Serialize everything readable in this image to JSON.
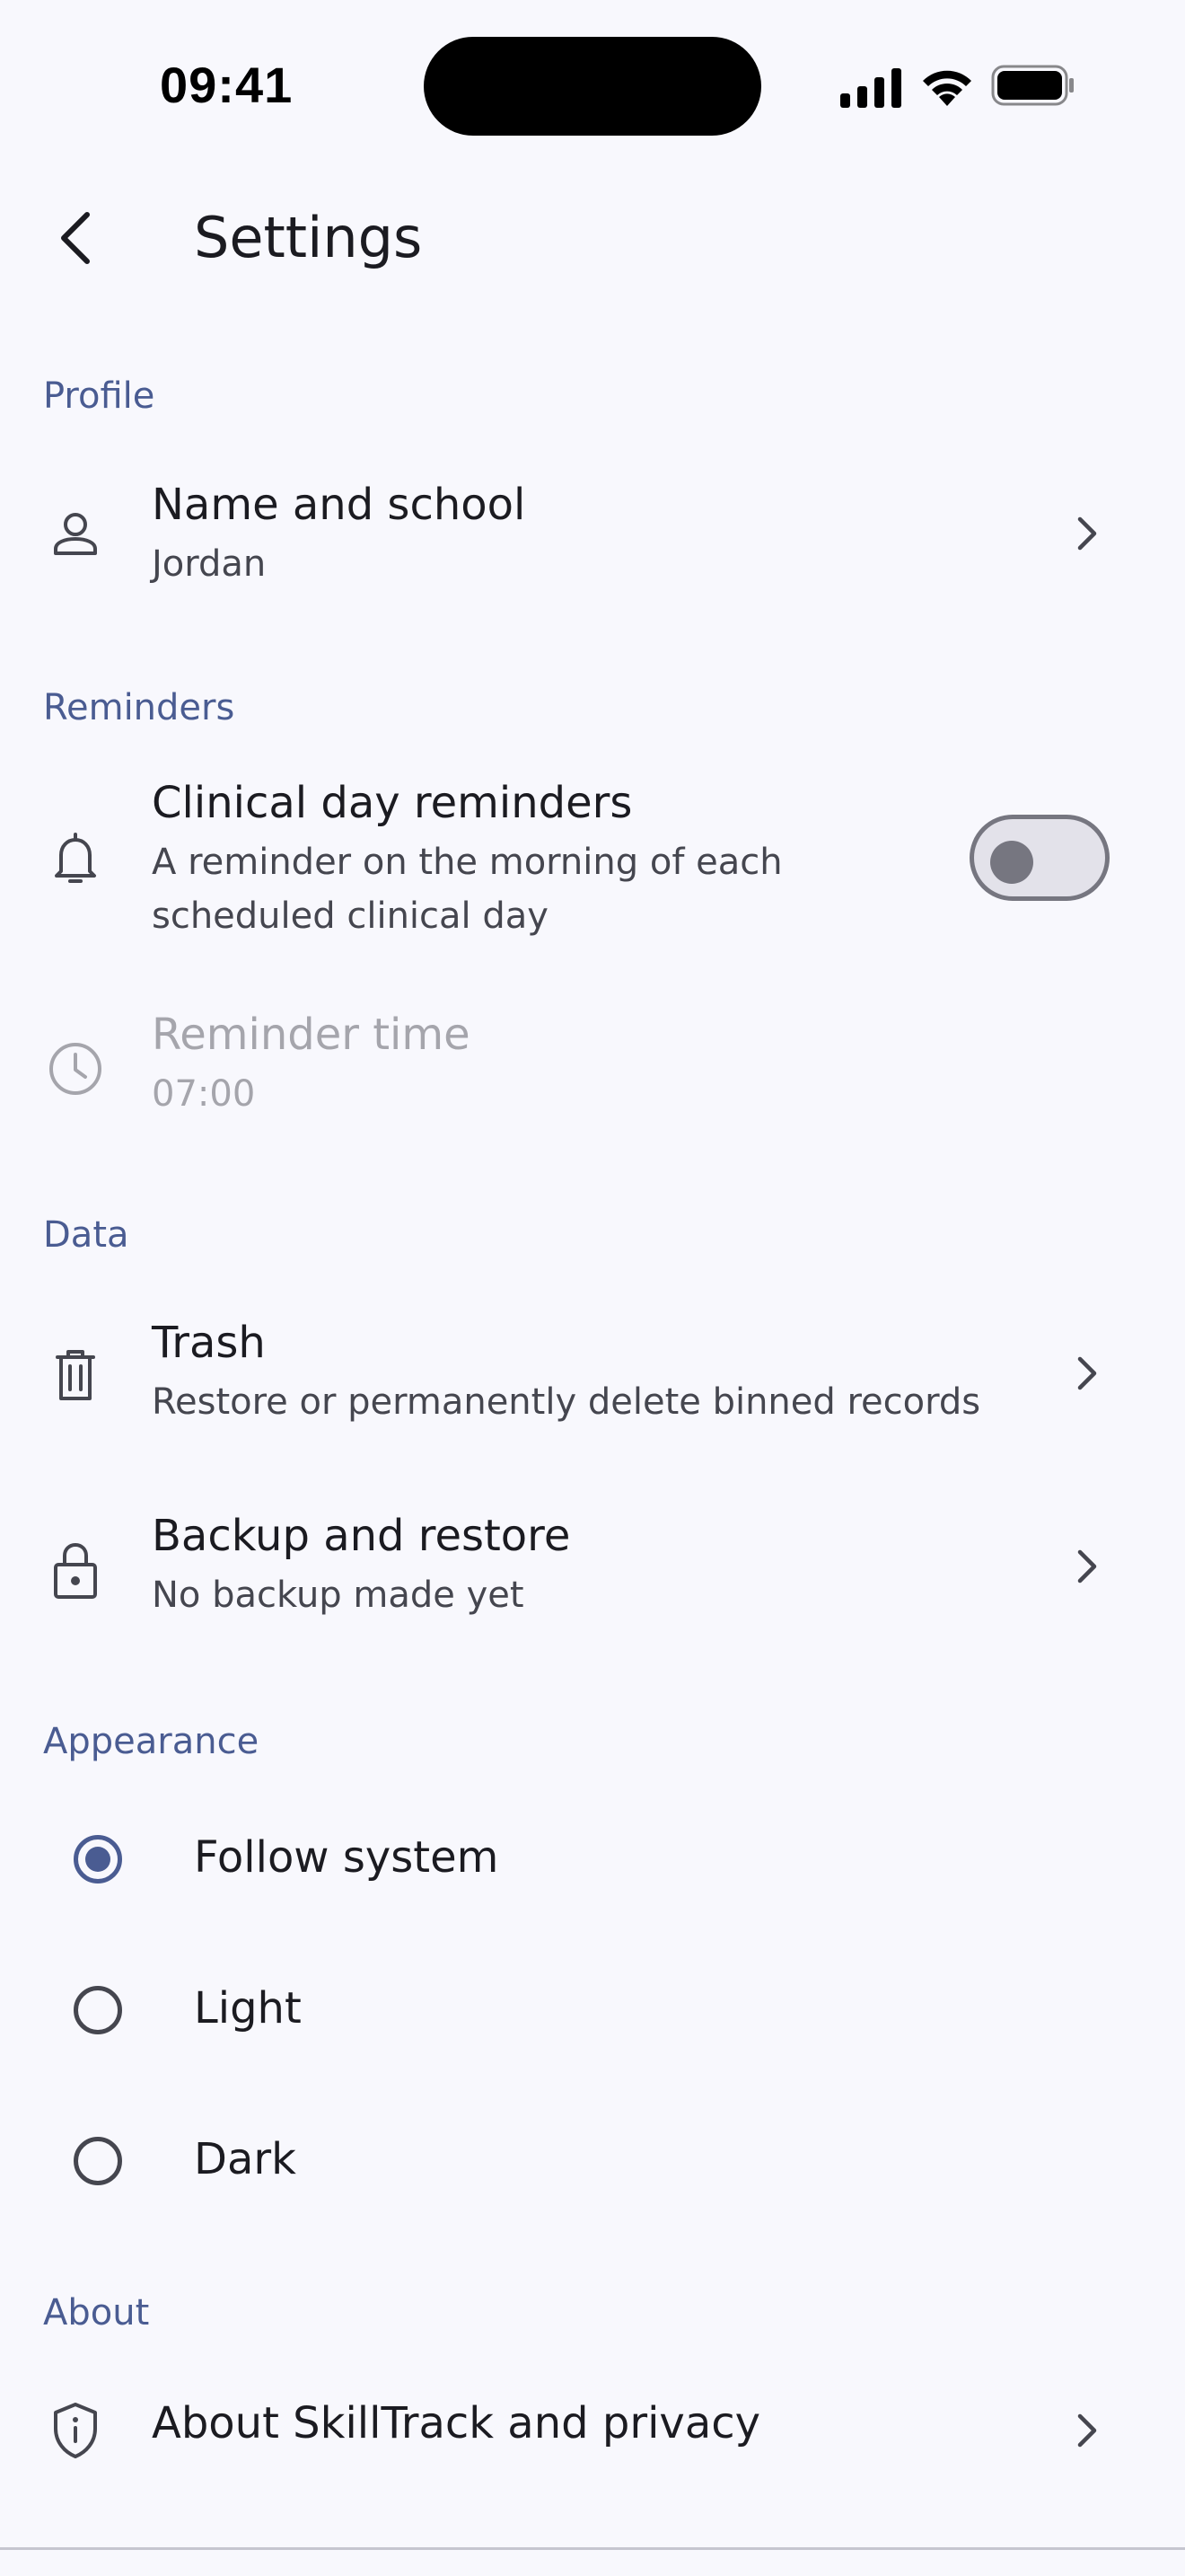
{
  "status_bar": {
    "time": "09:41"
  },
  "app_bar": {
    "title": "Settings"
  },
  "sections": {
    "profile": {
      "header": "Profile",
      "name_row": {
        "title": "Name and school",
        "subtitle": "Jordan"
      }
    },
    "reminders": {
      "header": "Reminders",
      "clinical_row": {
        "title": "Clinical day reminders",
        "subtitle_line1": "A reminder on the morning of each",
        "subtitle_line2": "scheduled clinical day",
        "enabled": false
      },
      "time_row": {
        "title": "Reminder time",
        "subtitle": "07:00"
      }
    },
    "data": {
      "header": "Data",
      "trash_row": {
        "title": "Trash",
        "subtitle": "Restore or permanently delete binned records"
      },
      "backup_row": {
        "title": "Backup and restore",
        "subtitle": "No backup made yet"
      }
    },
    "appearance": {
      "header": "Appearance",
      "options": [
        {
          "label": "Follow system",
          "selected": true
        },
        {
          "label": "Light",
          "selected": false
        },
        {
          "label": "Dark",
          "selected": false
        }
      ]
    },
    "about": {
      "header": "About",
      "about_row": {
        "title": "About SkillTrack and privacy"
      }
    }
  },
  "colors": {
    "background": "#f8f8fd",
    "accent": "#4a5c92",
    "text_primary": "#1b1b21",
    "text_secondary": "#45464f",
    "disabled": "#a5a5ac"
  },
  "icons": {
    "back": "arrow-back-icon",
    "profile": "person-icon",
    "reminders": "bell-icon",
    "reminder_time": "clock-icon",
    "trash": "trash-icon",
    "backup": "lock-icon",
    "about": "shield-info-icon",
    "chevron": "chevron-right-icon"
  }
}
